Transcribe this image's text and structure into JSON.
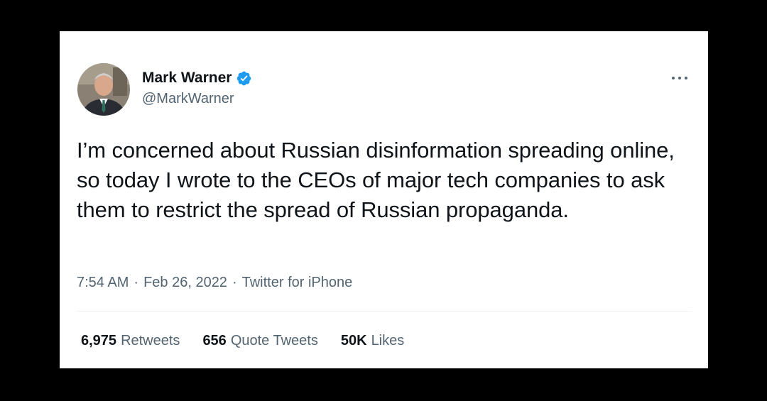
{
  "tweet": {
    "author_name": "Mark Warner",
    "handle": "@MarkWarner",
    "verified": true,
    "avatar_icon": "profile-photo",
    "more_icon": "more-horizontal-icon",
    "text": "I’m concerned about Russian disinformation spreading online, so today I wrote to the CEOs of major tech companies to ask them to restrict the spread of Russian propaganda.",
    "time": "7:54 AM",
    "date": "Feb 26, 2022",
    "source": "Twitter for iPhone",
    "separator": "·",
    "stats": [
      {
        "count": "6,975",
        "label": "Retweets"
      },
      {
        "count": "656",
        "label": "Quote Tweets"
      },
      {
        "count": "50K",
        "label": "Likes"
      }
    ]
  },
  "colors": {
    "background": "#000000",
    "card": "#ffffff",
    "text_primary": "#0f1419",
    "text_secondary": "#536471",
    "verified_blue": "#1d9bf0",
    "divider": "#eff3f4"
  }
}
